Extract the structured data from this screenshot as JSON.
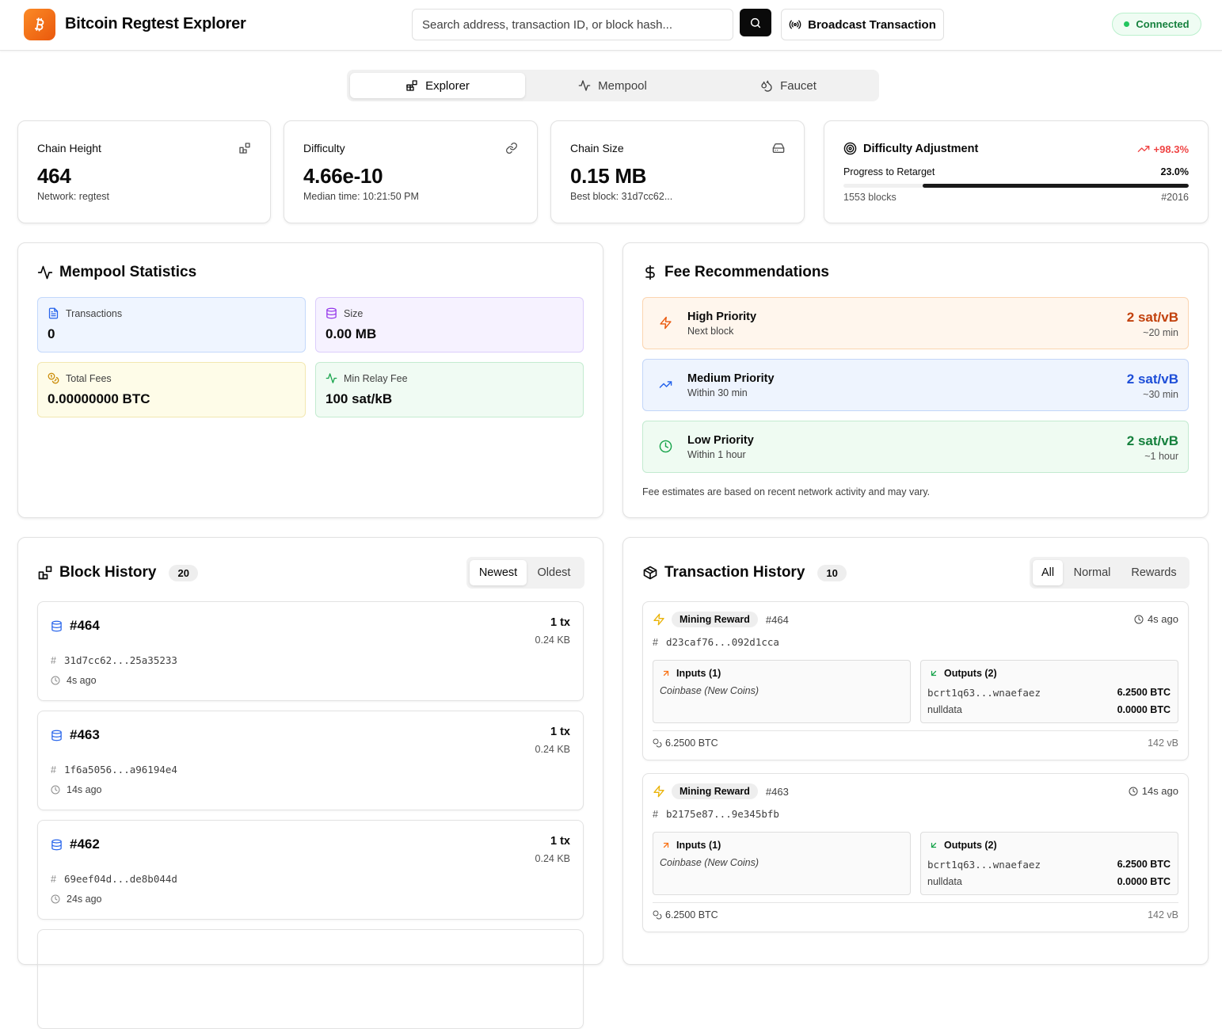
{
  "header": {
    "title": "Bitcoin Regtest Explorer",
    "search_placeholder": "Search address, transaction ID, or block hash...",
    "broadcast_label": "Broadcast Transaction",
    "status": "Connected"
  },
  "tabs": [
    {
      "label": "Explorer",
      "icon": "blocks-icon",
      "active": true
    },
    {
      "label": "Mempool",
      "icon": "activity-icon",
      "active": false
    },
    {
      "label": "Faucet",
      "icon": "droplets-icon",
      "active": false
    }
  ],
  "stats": {
    "chain_height": {
      "label": "Chain Height",
      "value": "464",
      "sub": "Network: regtest"
    },
    "difficulty": {
      "label": "Difficulty",
      "value": "4.66e-10",
      "sub": "Median time: 10:21:50 PM"
    },
    "chain_size": {
      "label": "Chain Size",
      "value": "0.15 MB",
      "sub": "Best block: 31d7cc62..."
    },
    "adjustment": {
      "label": "Difficulty Adjustment",
      "change": "+98.3%",
      "progress_label": "Progress to Retarget",
      "progress": "23.0%",
      "progress_fraction": 0.23,
      "blocks_left": "1553 blocks",
      "target": "#2016"
    }
  },
  "mempool": {
    "title": "Mempool Statistics",
    "transactions": {
      "label": "Transactions",
      "value": "0"
    },
    "size": {
      "label": "Size",
      "value": "0.00 MB"
    },
    "total_fees": {
      "label": "Total Fees",
      "value": "0.00000000 BTC"
    },
    "min_relay": {
      "label": "Min Relay Fee",
      "value": "100 sat/kB"
    }
  },
  "fees": {
    "title": "Fee Recommendations",
    "high": {
      "name": "High Priority",
      "sub": "Next block",
      "rate": "2 sat/vB",
      "time": "~20 min",
      "color": "#c2410c"
    },
    "medium": {
      "name": "Medium Priority",
      "sub": "Within 30 min",
      "rate": "2 sat/vB",
      "time": "~30 min",
      "color": "#1d4ed8"
    },
    "low": {
      "name": "Low Priority",
      "sub": "Within 1 hour",
      "rate": "2 sat/vB",
      "time": "~1 hour",
      "color": "#15803d"
    },
    "note": "Fee estimates are based on recent network activity and may vary."
  },
  "blocks": {
    "title": "Block History",
    "count": "20",
    "sort": [
      "Newest",
      "Oldest"
    ],
    "items": [
      {
        "height": "#464",
        "tx": "1 tx",
        "size": "0.24 KB",
        "hash": "31d7cc62...25a35233",
        "ago": "4s ago"
      },
      {
        "height": "#463",
        "tx": "1 tx",
        "size": "0.24 KB",
        "hash": "1f6a5056...a96194e4",
        "ago": "14s ago"
      },
      {
        "height": "#462",
        "tx": "1 tx",
        "size": "0.24 KB",
        "hash": "69eef04d...de8b044d",
        "ago": "24s ago"
      }
    ]
  },
  "transactions": {
    "title": "Transaction History",
    "count": "10",
    "filters": [
      "All",
      "Normal",
      "Rewards"
    ],
    "items": [
      {
        "type": "Mining Reward",
        "block": "#464",
        "ago": "4s ago",
        "txid": "d23caf76...092d1cca",
        "inputs_label": "Inputs (1)",
        "input_coinbase": "Coinbase (New Coins)",
        "outputs_label": "Outputs (2)",
        "outputs": [
          {
            "addr": "bcrt1q63...wnaefaez",
            "amount": "6.2500 BTC"
          },
          {
            "addr": "nulldata",
            "amount": "0.0000 BTC"
          }
        ],
        "total": "6.2500 BTC",
        "vsize": "142 vB"
      },
      {
        "type": "Mining Reward",
        "block": "#463",
        "ago": "14s ago",
        "txid": "b2175e87...9e345bfb",
        "inputs_label": "Inputs (1)",
        "input_coinbase": "Coinbase (New Coins)",
        "outputs_label": "Outputs (2)",
        "outputs": [
          {
            "addr": "bcrt1q63...wnaefaez",
            "amount": "6.2500 BTC"
          },
          {
            "addr": "nulldata",
            "amount": "0.0000 BTC"
          }
        ],
        "total": "6.2500 BTC",
        "vsize": "142 vB"
      }
    ]
  }
}
